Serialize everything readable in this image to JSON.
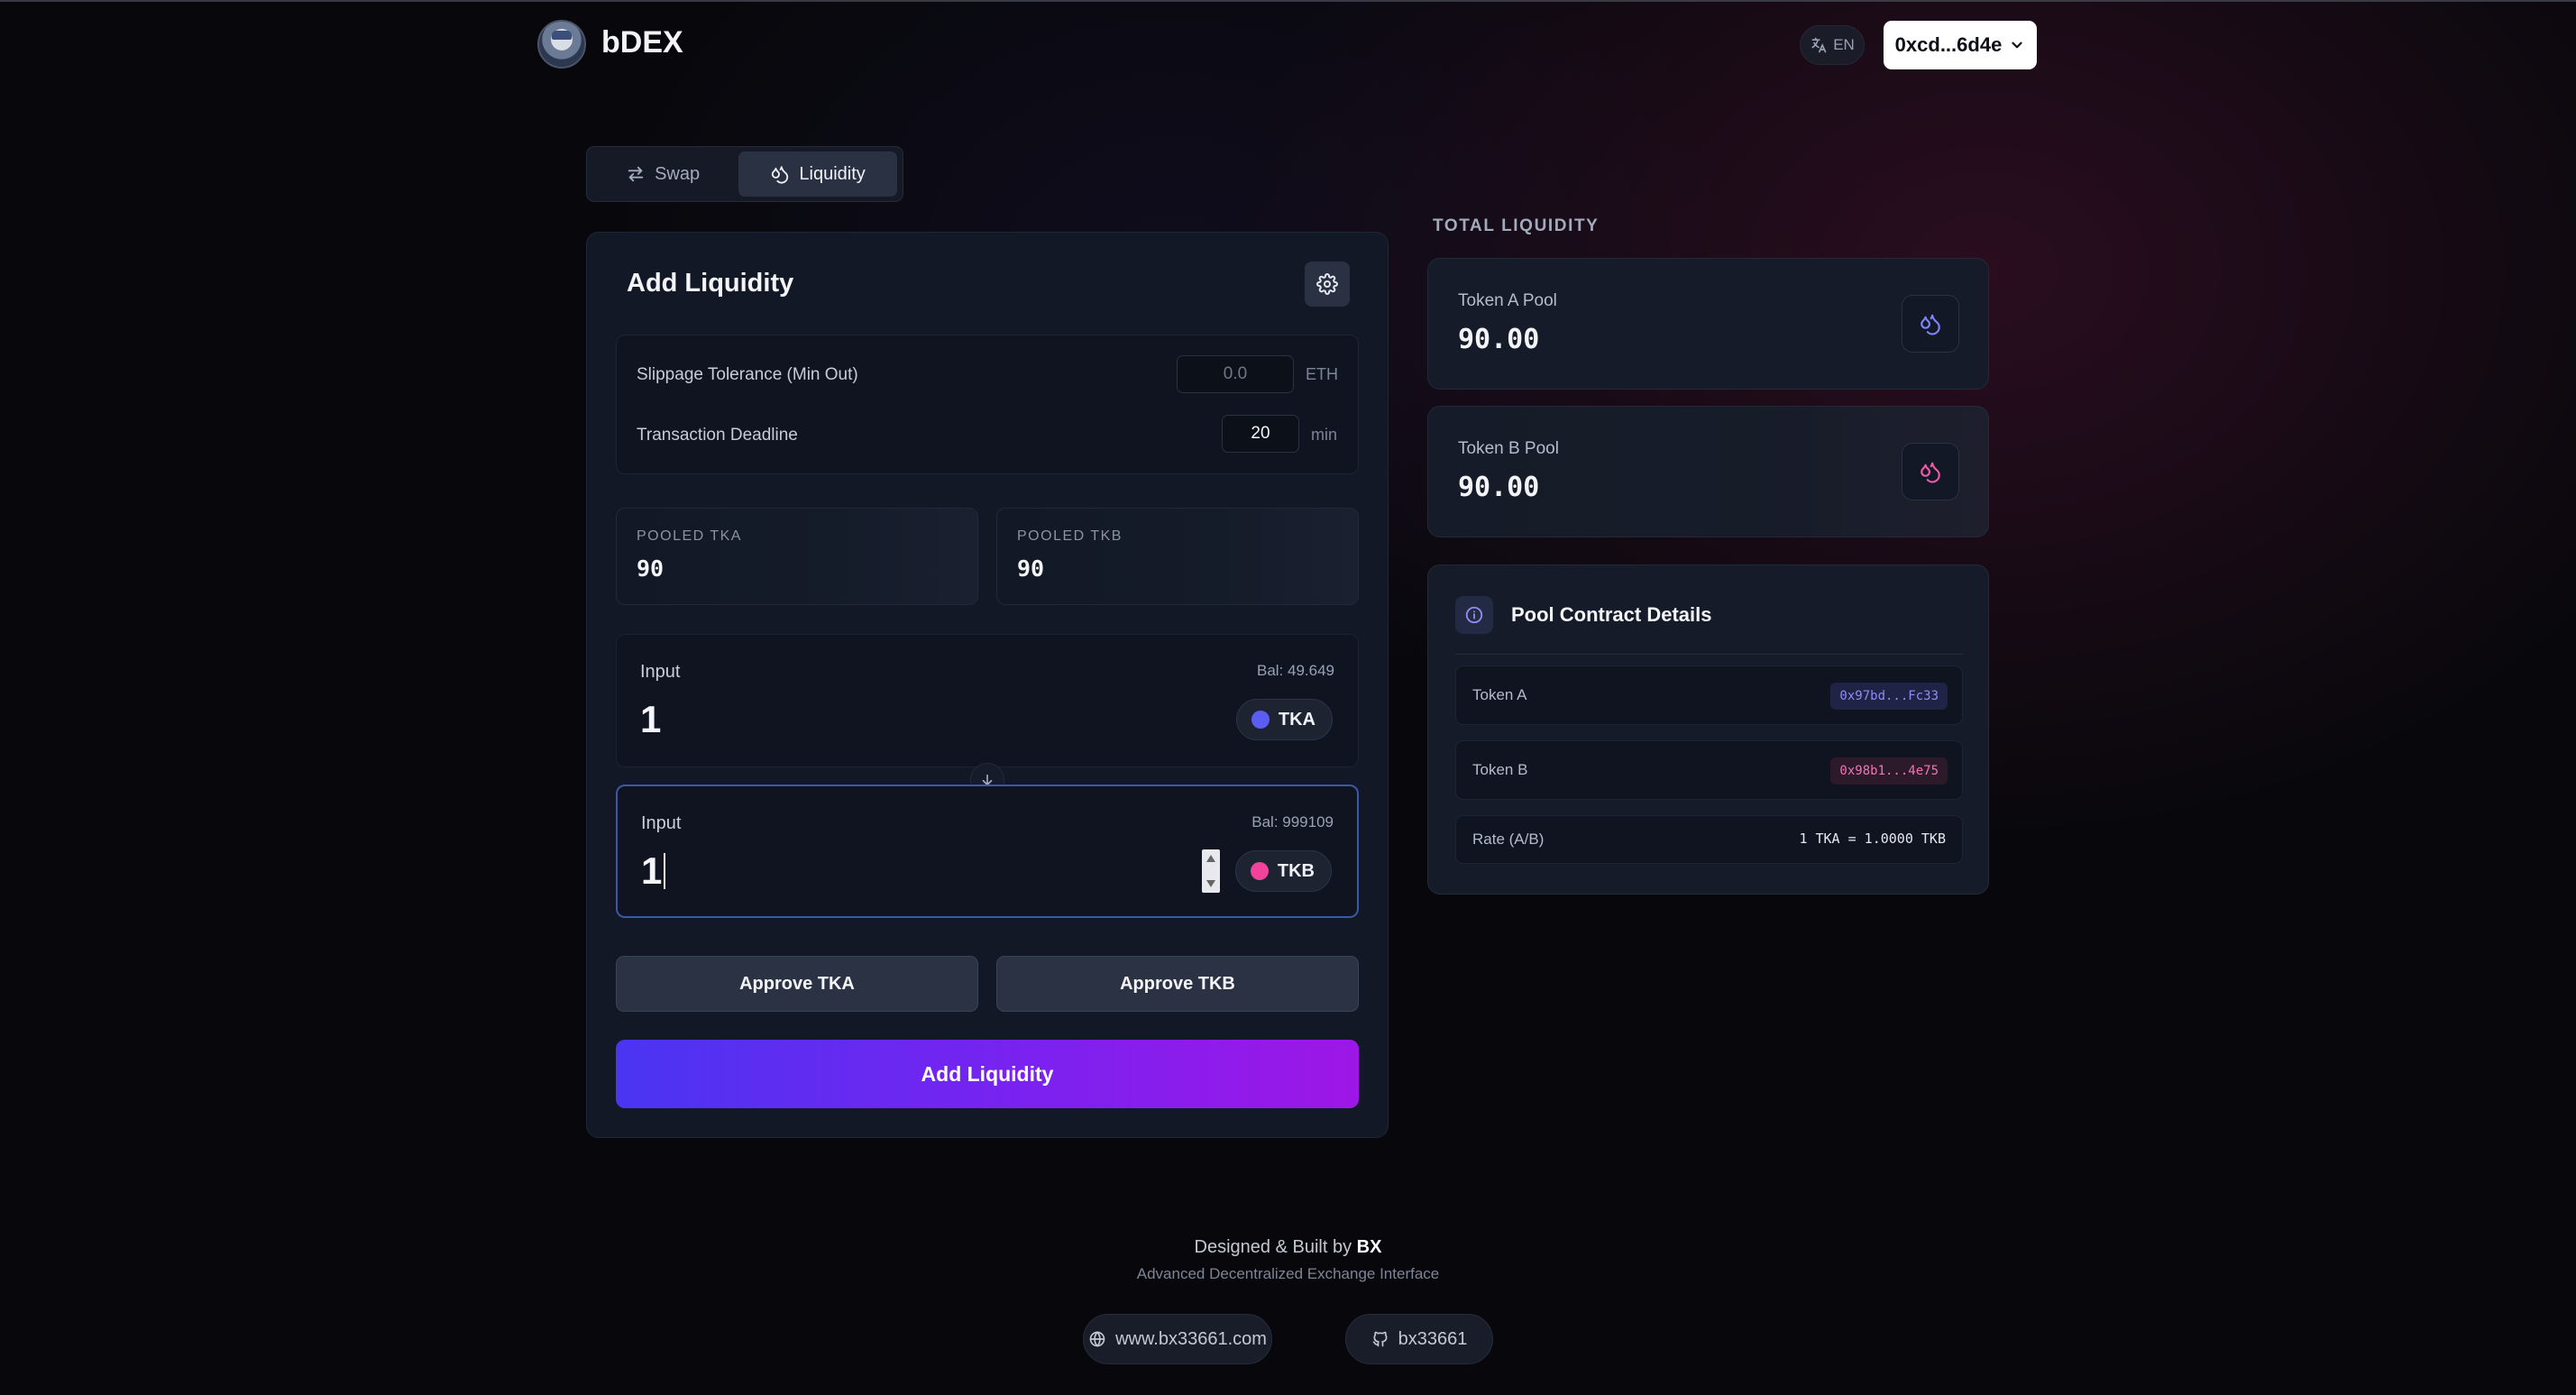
{
  "header": {
    "brand": "bDEX",
    "language": "EN",
    "wallet": "0xcd...6d4e"
  },
  "tabs": [
    {
      "label": "Swap",
      "icon": "swap-arrows-icon",
      "active": false
    },
    {
      "label": "Liquidity",
      "icon": "droplet-icon",
      "active": true
    }
  ],
  "card": {
    "title": "Add Liquidity",
    "settings": {
      "slippage_label": "Slippage Tolerance (Min Out)",
      "slippage_placeholder": "0.0",
      "slippage_unit": "ETH",
      "deadline_label": "Transaction Deadline",
      "deadline_value": "20",
      "deadline_unit": "min"
    },
    "pooled": [
      {
        "label": "POOLED TKA",
        "value": "90"
      },
      {
        "label": "POOLED TKB",
        "value": "90"
      }
    ],
    "inputs": [
      {
        "label": "Input",
        "balance": "Bal: 49.649",
        "value": "1",
        "token": "TKA",
        "token_color": "#5b5cf0"
      },
      {
        "label": "Input",
        "balance": "Bal: 999109",
        "value": "1",
        "token": "TKB",
        "token_color": "#f0449c"
      }
    ],
    "approve_a": "Approve TKA",
    "approve_b": "Approve TKB",
    "submit": "Add Liquidity"
  },
  "total": {
    "caption": "TOTAL LIQUIDITY",
    "pools": [
      {
        "label": "Token A Pool",
        "value": "90.00",
        "icon_color": "#7f84f5"
      },
      {
        "label": "Token B Pool",
        "value": "90.00",
        "icon_color": "#f05aa6"
      }
    ]
  },
  "details": {
    "title": "Pool Contract Details",
    "rows": [
      {
        "label": "Token A",
        "value": "0x97bd...Fc33"
      },
      {
        "label": "Token B",
        "value": "0x98b1...4e75"
      },
      {
        "label": "Rate (A/B)",
        "value": "1 TKA = 1.0000 TKB"
      }
    ]
  },
  "footer": {
    "credit_prefix": "Designed & Built by",
    "credit_name": "BX",
    "tagline": "Advanced Decentralized Exchange Interface",
    "website": "www.bx33661.com",
    "github": "bx33661"
  }
}
